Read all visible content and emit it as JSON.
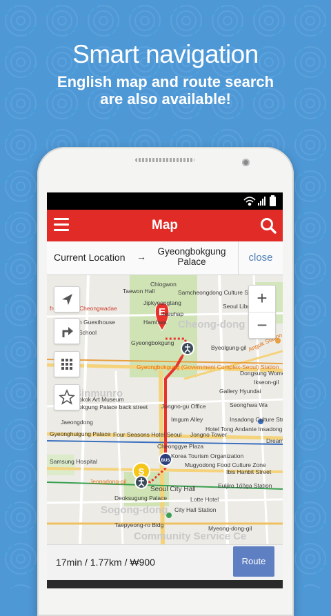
{
  "promo": {
    "headline": "Smart navigation",
    "subline_1": "English map and route search",
    "subline_2": "are also available!"
  },
  "colors": {
    "background": "#4f98d6",
    "appbar": "#e02b26",
    "route_button": "#5f7fc3",
    "route_line": "#e8332c",
    "close_link": "#4e7fb8"
  },
  "appbar": {
    "title": "Map",
    "menu_icon": "hamburger-menu-icon",
    "search_icon": "search-icon"
  },
  "route": {
    "from": "Current Location",
    "arrow": "→",
    "to_line1": "Gyeongbokgung",
    "to_line2": "Palace",
    "close_label": "close"
  },
  "map_controls": {
    "zoom_in": "+",
    "zoom_out": "−",
    "left_buttons": [
      "my-location-icon",
      "turn-directions-icon",
      "grid-view-icon",
      "favorite-star-icon"
    ]
  },
  "markers": {
    "end": "E",
    "start": "S",
    "bus": "BUS"
  },
  "map_labels": {
    "taewon_hall": "Taewon Hall",
    "chiogwon": "Chiogwon",
    "samcheong": "Samcheongdong Culture Street",
    "cheongwadae": "front of the Cheongwadae",
    "jipkyeong": "Jipkyeongtang",
    "seoul_library": "Seoul Library",
    "guesthouse": "n Guesthouse",
    "jesuhap": "Jesuhap",
    "hamhwa": "Hamhwa",
    "school": "School",
    "gyeongbok_label": "Gyeongbokgung",
    "byeolgung": "Byeolgung-gil",
    "gwanghwamun": "Gyeongbokgung (Government Complex-Seoul) Station",
    "anguk": "Anguk Station",
    "dongsung": "Dongsung Women's",
    "ikseon": "Ikseon-gil",
    "gallery": "Gallery Hyundai",
    "bokok": "okok Art Museum",
    "palace_back": "okgung Palace back street",
    "jongno_office": "Jongno-gu Office",
    "seonghwa": "Seonghwa Wa",
    "imgum": "Imgum Alley",
    "insadong": "Insadong Culture Street",
    "jaeongdon": "Jaeongdong",
    "ghpalace": "Gyeonghuigung Palace",
    "fourseasons": "Four Seasons Hotel Seoul",
    "jongno_tower": "Jongno Tower",
    "andante": "Hotel Tong Andante Insadong",
    "dream": "Dream",
    "cheonggye": "Cheonggye Plaza",
    "kto": "Korea Tourism Organization",
    "samsung": "Samsung Hospital",
    "mugyodong": "Mugyodong Food Culture Zone",
    "ibis": "Ibis Hanbit Street",
    "jeongdong": "Jeongdong-gil",
    "cityhall": "Seoul City Hall",
    "euljiro": "Euljiro 1(il)ga Station",
    "deoksu": "Deoksugung Palace",
    "lotte": "Lotte Hotel",
    "cityhall_stn": "City Hall Station",
    "sogong": "Sogong-dong",
    "taepyeong": "Taepyeong-ro Bldg",
    "myeongdong": "Myeong-dong-gil",
    "community": "Community Service Ce",
    "sinmun": "Sinmunro",
    "cheongdong": "Cheong-dong",
    "haejang": "Yajin-dong"
  },
  "summary": {
    "text": "17min / 1.77km / ₩900",
    "route_label": "Route"
  },
  "system": {
    "status_icons": [
      "wifi-icon",
      "signal-icon",
      "battery-icon"
    ]
  }
}
